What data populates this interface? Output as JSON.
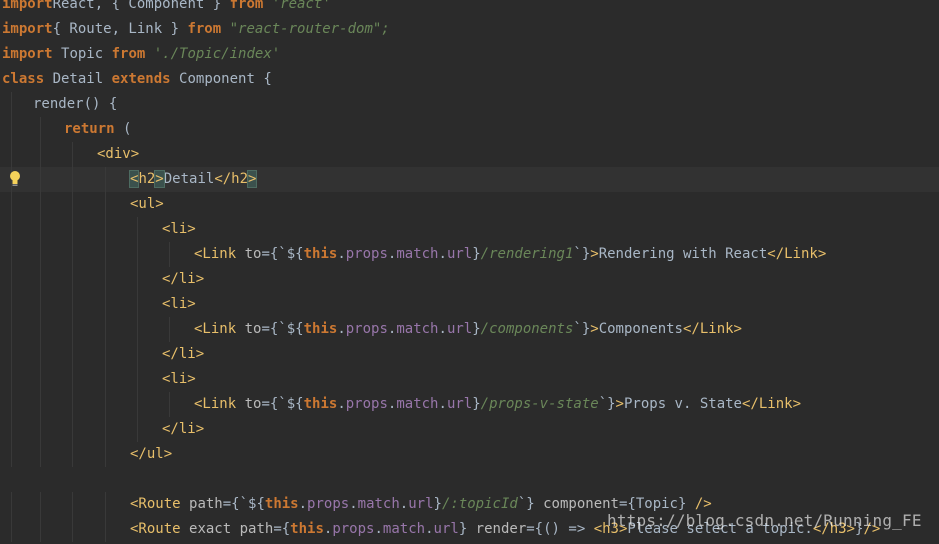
{
  "editor": {
    "lines": [
      [
        [
          "kw",
          "import"
        ],
        [
          "",
          "React, { Component } "
        ],
        [
          "kw",
          "from "
        ],
        [
          "str",
          "'react'"
        ]
      ],
      [
        [
          "kw",
          "import"
        ],
        [
          "",
          "{ Route, Link } "
        ],
        [
          "kw",
          "from "
        ],
        [
          "str",
          "\"react-router-dom\";"
        ]
      ],
      [
        [
          "kw",
          "import "
        ],
        [
          "",
          "Topic "
        ],
        [
          "kw",
          "from "
        ],
        [
          "str",
          "'./Topic/index'"
        ]
      ],
      [
        [
          "kw",
          "class "
        ],
        [
          "",
          "Detail "
        ],
        [
          "kw",
          "extends "
        ],
        [
          "",
          "Component {"
        ]
      ],
      [
        [
          "",
          "render() {"
        ]
      ],
      [
        [
          "kw",
          "return "
        ],
        [
          "",
          "("
        ]
      ],
      [
        [
          "tag",
          "<div>"
        ]
      ],
      [
        [
          "brk",
          "<"
        ],
        [
          "tag",
          "h2"
        ],
        [
          "brk",
          ">"
        ],
        [
          "",
          "Detail"
        ],
        [
          "tag",
          "</h2"
        ],
        [
          "brk",
          ">"
        ]
      ],
      [
        [
          "tag",
          "<ul>"
        ]
      ],
      [
        [
          "tag",
          "<li>"
        ]
      ],
      [
        [
          "tag",
          "<Link "
        ],
        [
          "attr",
          "to"
        ],
        [
          "",
          "={`${"
        ],
        [
          "kw",
          "this"
        ],
        [
          "",
          "."
        ],
        [
          "prop",
          "props"
        ],
        [
          "",
          "."
        ],
        [
          "prop",
          "match"
        ],
        [
          "",
          "."
        ],
        [
          "prop",
          "url"
        ],
        [
          "",
          "}"
        ],
        [
          "str",
          "/rendering1"
        ],
        [
          "",
          "`}"
        ],
        [
          "tag",
          ">"
        ],
        [
          "",
          "Rendering with React"
        ],
        [
          "tag",
          "</Link>"
        ]
      ],
      [
        [
          "tag",
          "</li>"
        ]
      ],
      [
        [
          "tag",
          "<li>"
        ]
      ],
      [
        [
          "tag",
          "<Link "
        ],
        [
          "attr",
          "to"
        ],
        [
          "",
          "={`${"
        ],
        [
          "kw",
          "this"
        ],
        [
          "",
          "."
        ],
        [
          "prop",
          "props"
        ],
        [
          "",
          "."
        ],
        [
          "prop",
          "match"
        ],
        [
          "",
          "."
        ],
        [
          "prop",
          "url"
        ],
        [
          "",
          "}"
        ],
        [
          "str",
          "/components"
        ],
        [
          "",
          "`}"
        ],
        [
          "tag",
          ">"
        ],
        [
          "",
          "Components"
        ],
        [
          "tag",
          "</Link>"
        ]
      ],
      [
        [
          "tag",
          "</li>"
        ]
      ],
      [
        [
          "tag",
          "<li>"
        ]
      ],
      [
        [
          "tag",
          "<Link "
        ],
        [
          "attr",
          "to"
        ],
        [
          "",
          "={`${"
        ],
        [
          "kw",
          "this"
        ],
        [
          "",
          "."
        ],
        [
          "prop",
          "props"
        ],
        [
          "",
          "."
        ],
        [
          "prop",
          "match"
        ],
        [
          "",
          "."
        ],
        [
          "prop",
          "url"
        ],
        [
          "",
          "}"
        ],
        [
          "str",
          "/props-v-state"
        ],
        [
          "",
          "`}"
        ],
        [
          "tag",
          ">"
        ],
        [
          "",
          "Props v. State"
        ],
        [
          "tag",
          "</Link>"
        ]
      ],
      [
        [
          "tag",
          "</li>"
        ]
      ],
      [
        [
          "tag",
          "</ul>"
        ]
      ],
      [],
      [
        [
          "tag",
          "<Route "
        ],
        [
          "attr",
          "path"
        ],
        [
          "",
          "={`${"
        ],
        [
          "kw",
          "this"
        ],
        [
          "",
          "."
        ],
        [
          "prop",
          "props"
        ],
        [
          "",
          "."
        ],
        [
          "prop",
          "match"
        ],
        [
          "",
          "."
        ],
        [
          "prop",
          "url"
        ],
        [
          "",
          "}"
        ],
        [
          "str",
          "/:topicId"
        ],
        [
          "",
          "`} "
        ],
        [
          "attr",
          "component"
        ],
        [
          "",
          "={Topic} "
        ],
        [
          "tag",
          "/>"
        ]
      ],
      [
        [
          "tag",
          "<Route "
        ],
        [
          "attr",
          "exact "
        ],
        [
          "attr",
          "path"
        ],
        [
          "",
          "={"
        ],
        [
          "kw",
          "this"
        ],
        [
          "",
          "."
        ],
        [
          "prop",
          "props"
        ],
        [
          "",
          "."
        ],
        [
          "prop",
          "match"
        ],
        [
          "",
          "."
        ],
        [
          "prop",
          "url"
        ],
        [
          "",
          "} "
        ],
        [
          "attr",
          "render"
        ],
        [
          "",
          "={() => "
        ],
        [
          "tag",
          "<h3>"
        ],
        [
          "",
          "Please select a topic."
        ],
        [
          "tag",
          "</h3>"
        ],
        [
          "",
          "}"
        ],
        [
          "tag",
          "/>"
        ]
      ]
    ]
  },
  "watermark": "https://blog.csdn.net/Running_FE",
  "colors": {
    "background": "#2b2b2b",
    "current_line": "#323232",
    "keyword": "#cc7832",
    "string": "#6a8759",
    "tag": "#e8bf6a",
    "attribute": "#bababa",
    "property": "#9876aa",
    "text": "#a9b7c6"
  },
  "icons": {
    "gutter_hint": "lightbulb-icon"
  }
}
